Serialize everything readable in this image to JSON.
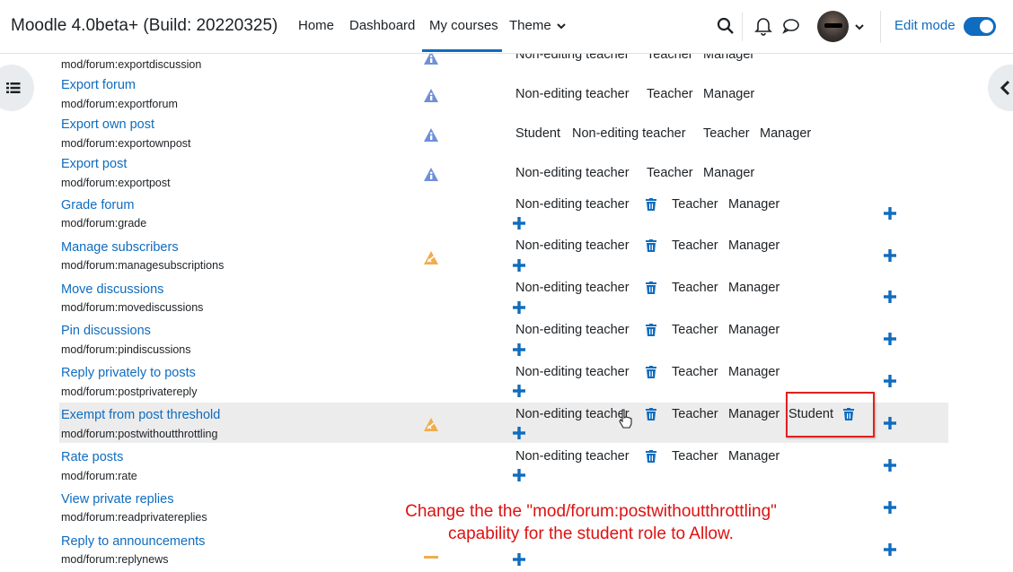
{
  "navbar": {
    "brand": "Moodle 4.0beta+ (Build: 20220325)",
    "links": [
      {
        "label": "Home"
      },
      {
        "label": "Dashboard"
      },
      {
        "label": "My courses"
      },
      {
        "label": "Theme"
      }
    ],
    "edit_mode_label": "Edit mode",
    "edit_mode_on": true
  },
  "capabilities": [
    {
      "title": "",
      "name": "mod/forum:exportdiscussion",
      "risk": "info",
      "roles": [
        "Non-editing teacher",
        "Teacher",
        "Manager"
      ]
    },
    {
      "title": "Export forum",
      "name": "mod/forum:exportforum",
      "risk": "info",
      "roles": [
        "Non-editing teacher",
        "Teacher",
        "Manager"
      ]
    },
    {
      "title": "Export own post",
      "name": "mod/forum:exportownpost",
      "risk": "info",
      "roles": [
        "Student",
        "Non-editing teacher",
        "Teacher",
        "Manager"
      ]
    },
    {
      "title": "Export post",
      "name": "mod/forum:exportpost",
      "risk": "info",
      "roles": [
        "Non-editing teacher",
        "Teacher",
        "Manager"
      ]
    },
    {
      "title": "Grade forum",
      "name": "mod/forum:grade",
      "risk": "none",
      "roles": [
        "Non-editing teacher",
        "Teacher",
        "Manager"
      ]
    },
    {
      "title": "Manage subscribers",
      "name": "mod/forum:managesubscriptions",
      "risk": "warning",
      "roles": [
        "Non-editing teacher",
        "Teacher",
        "Manager"
      ]
    },
    {
      "title": "Move discussions",
      "name": "mod/forum:movediscussions",
      "risk": "none",
      "roles": [
        "Non-editing teacher",
        "Teacher",
        "Manager"
      ]
    },
    {
      "title": "Pin discussions",
      "name": "mod/forum:pindiscussions",
      "risk": "none",
      "roles": [
        "Non-editing teacher",
        "Teacher",
        "Manager"
      ]
    },
    {
      "title": "Reply privately to posts",
      "name": "mod/forum:postprivatereply",
      "risk": "none",
      "roles": [
        "Non-editing teacher",
        "Teacher",
        "Manager"
      ]
    },
    {
      "title": "Exempt from post threshold",
      "name": "mod/forum:postwithoutthrottling",
      "risk": "warning",
      "roles": [
        "Non-editing teacher",
        "Teacher",
        "Manager",
        "Student"
      ]
    },
    {
      "title": "Rate posts",
      "name": "mod/forum:rate",
      "risk": "none",
      "roles": [
        "Non-editing teacher",
        "Teacher",
        "Manager"
      ]
    },
    {
      "title": "View private replies",
      "name": "mod/forum:readprivatereplies",
      "risk": "none",
      "roles": []
    },
    {
      "title": "Reply to announcements",
      "name": "mod/forum:replynews",
      "risk": "warning",
      "roles": []
    }
  ],
  "annotation": {
    "line1": "Change the the \"mod/forum:postwithoutthrottling\"",
    "line2": "capability for the student role to Allow."
  },
  "icons": {
    "search": "search-icon",
    "bell": "bell-icon",
    "chat": "chat-icon",
    "info_risk": "info-risk-icon",
    "warning_risk": "warning-risk-icon",
    "trash": "trash-icon",
    "plus": "plus-icon"
  },
  "colors": {
    "primary": "#0f6cbf",
    "risk_info": "#6f8fd9",
    "risk_warning": "#f0ad4e",
    "annotation": "#dd1111"
  }
}
